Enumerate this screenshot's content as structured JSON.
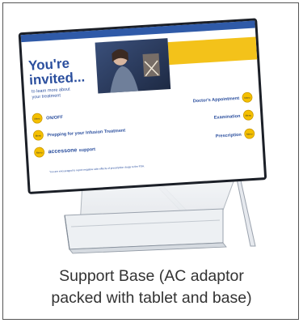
{
  "caption": {
    "line1": "Support Base (AC adaptor",
    "line2": "packed with tablet and base)"
  },
  "screen": {
    "headline_line1": "You're",
    "headline_line2": "invited...",
    "subtext_line1": "to learn more about",
    "subtext_line2": "your treatment",
    "items_left": [
      {
        "label": "ON/OFF",
        "button": "Menu"
      },
      {
        "label": "Prepping for your Infusion Treatment",
        "button": "Menu"
      },
      {
        "label": "support",
        "brand": "accessone",
        "button": "Menu"
      }
    ],
    "items_right": [
      {
        "label": "Doctor's Appointment",
        "button": "Menu"
      },
      {
        "label": "Examination",
        "button": "Menu"
      },
      {
        "label": "Prescription",
        "button": "Menu"
      }
    ],
    "disclaimer": "You are encouraged to report negative side effects of prescription drugs to the FDA.",
    "colors": {
      "top_band": "#2f5aa8",
      "accent_yellow": "#f3c21a",
      "headline": "#2b4f9e",
      "item_text": "#2b4f9e",
      "button_fill": "#f5c000"
    }
  }
}
